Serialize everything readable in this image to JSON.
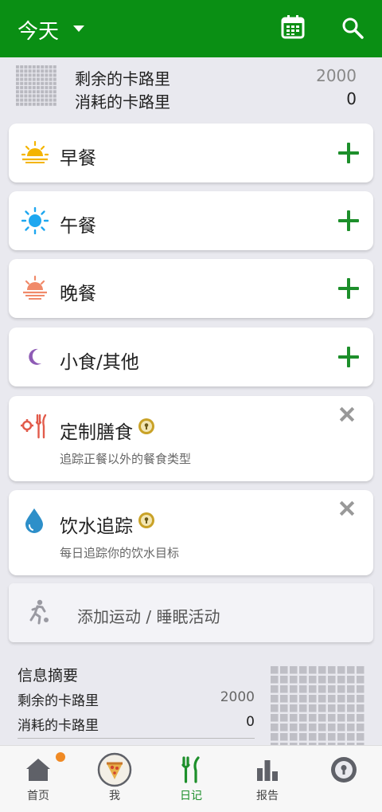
{
  "header": {
    "title": "今天",
    "calendar_icon": "calendar-icon",
    "search_icon": "search-icon"
  },
  "summary_top": {
    "remaining_label": "剩余的卡路里",
    "remaining_value": "2000",
    "consumed_label": "消耗的卡路里",
    "consumed_value": "0"
  },
  "meals": [
    {
      "label": "早餐",
      "icon": "sunrise-icon",
      "color": "#f4b400"
    },
    {
      "label": "午餐",
      "icon": "sun-icon",
      "color": "#1ea7f0"
    },
    {
      "label": "晚餐",
      "icon": "sunset-icon",
      "color": "#f08a6a"
    },
    {
      "label": "小食/其他",
      "icon": "moon-icon",
      "color": "#8e5bb5"
    }
  ],
  "features": [
    {
      "label": "定制膳食",
      "desc": "追踪正餐以外的餐食类型",
      "icon": "custom-meal-icon",
      "color": "#e25b4b"
    },
    {
      "label": "饮水追踪",
      "desc": "每日追踪你的饮水目标",
      "icon": "water-drop-icon",
      "color": "#2d8fc9"
    }
  ],
  "exercise": {
    "label": "添加运动 / 睡眠活动",
    "icon": "running-icon"
  },
  "info": {
    "heading": "信息摘要",
    "remaining_label": "剩余的卡路里",
    "remaining_value": "2000",
    "consumed_label": "消耗的卡路里",
    "consumed_value": "0"
  },
  "nav": [
    {
      "label": "首页",
      "icon": "home-icon"
    },
    {
      "label": "我",
      "icon": "pizza-avatar-icon"
    },
    {
      "label": "日记",
      "icon": "fork-knife-icon"
    },
    {
      "label": "报告",
      "icon": "bar-chart-icon"
    },
    {
      "label": "",
      "icon": "premium-lock-icon"
    }
  ],
  "colors": {
    "brand_green": "#0a8f14",
    "accent_orange": "#f08a24",
    "gold": "#c9a227"
  }
}
